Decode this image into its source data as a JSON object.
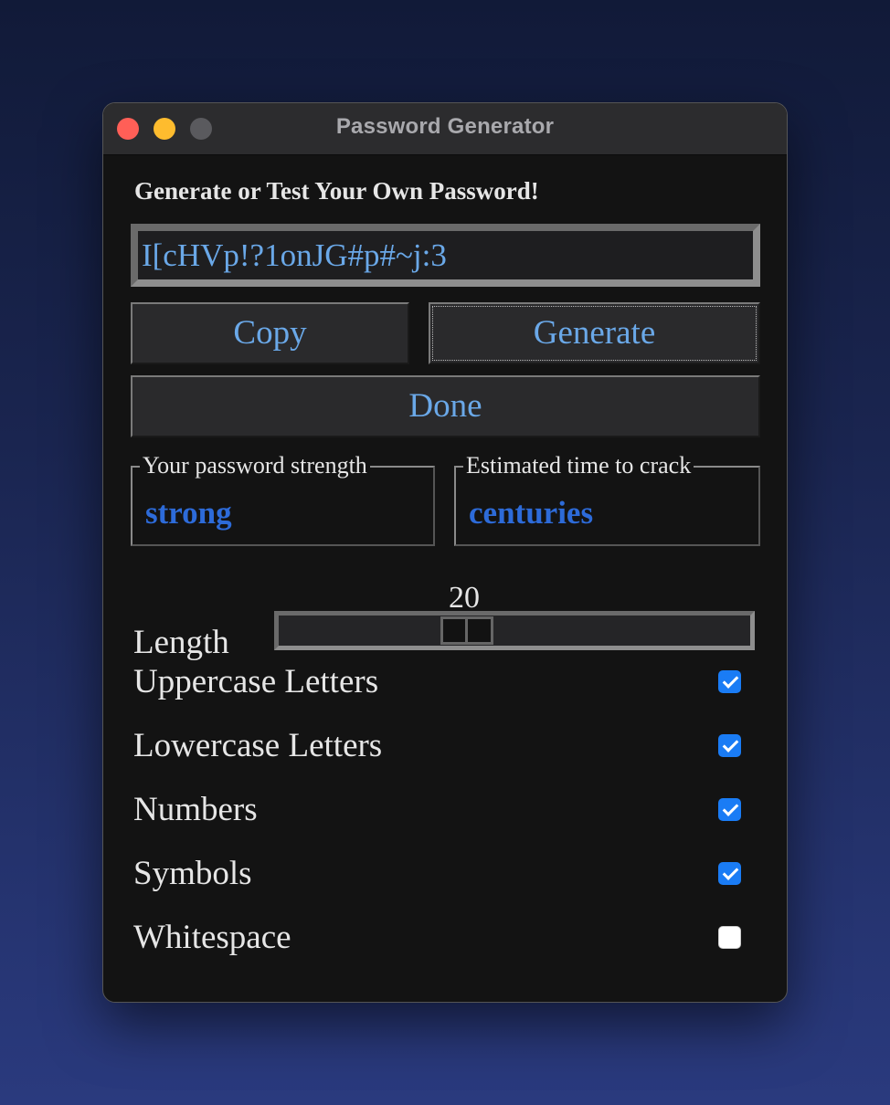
{
  "window": {
    "title": "Password Generator"
  },
  "heading": "Generate or Test Your Own Password!",
  "password": {
    "value": "I[cHVp!?1onJG#p#~j:3"
  },
  "buttons": {
    "copy": "Copy",
    "generate": "Generate",
    "done": "Done"
  },
  "strength": {
    "label": "Your password strength",
    "value": "strong"
  },
  "crack_time": {
    "label": "Estimated time to crack",
    "value": "centuries"
  },
  "length": {
    "label": "Length",
    "value": "20"
  },
  "options": [
    {
      "label": "Uppercase Letters",
      "checked": true
    },
    {
      "label": "Lowercase Letters",
      "checked": true
    },
    {
      "label": "Numbers",
      "checked": true
    },
    {
      "label": "Symbols",
      "checked": true
    },
    {
      "label": "Whitespace",
      "checked": false
    }
  ],
  "colors": {
    "accent_text": "#6aa8e8",
    "strength_text": "#2d6bd9",
    "checkbox_checked": "#1a7cf5",
    "window_bg": "#131313"
  }
}
